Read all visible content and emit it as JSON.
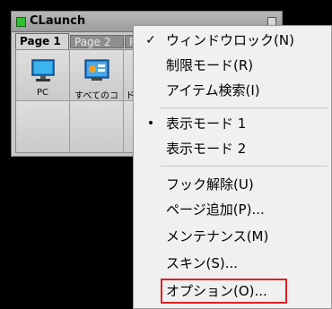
{
  "window": {
    "title": "CLaunch",
    "tabs": [
      "Page 1",
      "Page 2",
      "P"
    ],
    "cells": [
      {
        "label": "PC",
        "icon": "monitor-icon"
      },
      {
        "label": "すべてのコ",
        "icon": "control-panel-icon"
      },
      {
        "label": "ド",
        "icon": ""
      }
    ]
  },
  "menu": {
    "items": [
      {
        "label": "ウィンドウロック(N)",
        "mark": "✓"
      },
      {
        "label": "制限モード(R)",
        "mark": ""
      },
      {
        "label": "アイテム検索(I)",
        "mark": ""
      },
      {
        "label": "表示モード 1",
        "mark": "•"
      },
      {
        "label": "表示モード 2",
        "mark": ""
      },
      {
        "label": "フック解除(U)",
        "mark": ""
      },
      {
        "label": "ページ追加(P)...",
        "mark": ""
      },
      {
        "label": "メンテナンス(M)",
        "mark": ""
      },
      {
        "label": "スキン(S)...",
        "mark": ""
      },
      {
        "label": "オプション(O)...",
        "mark": ""
      }
    ],
    "highlight_color": "#e02020"
  }
}
